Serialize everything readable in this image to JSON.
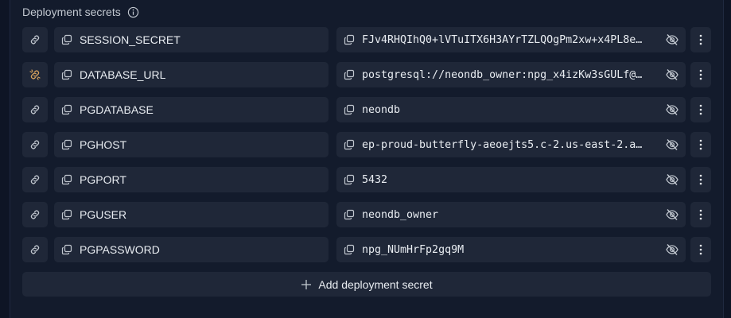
{
  "header": {
    "title": "Deployment secrets",
    "info_icon": "info-icon"
  },
  "secrets": [
    {
      "key": "SESSION_SECRET",
      "value": "FJv4RHQIhQ0+lVTuITX6H3AYrTZLQOgPm2xw+x4PL8e…",
      "link_state": "linked"
    },
    {
      "key": "DATABASE_URL",
      "value": "postgresql://neondb_owner:npg_x4izKw3sGULf@…",
      "link_state": "unlinked"
    },
    {
      "key": "PGDATABASE",
      "value": "neondb",
      "link_state": "linked"
    },
    {
      "key": "PGHOST",
      "value": "ep-proud-butterfly-aeoejts5.c-2.us-east-2.a…",
      "link_state": "linked"
    },
    {
      "key": "PGPORT",
      "value": "5432",
      "link_state": "linked"
    },
    {
      "key": "PGUSER",
      "value": "neondb_owner",
      "link_state": "linked"
    },
    {
      "key": "PGPASSWORD",
      "value": "npg_NUmHrFp2gq9M",
      "link_state": "linked"
    }
  ],
  "add_button": {
    "label": "Add deployment secret",
    "icon": "plus-icon"
  },
  "colors": {
    "background": "#0e1525",
    "panel": "#131b2c",
    "cell": "#1f2738",
    "unlinked_accent": "#d9a35e"
  }
}
